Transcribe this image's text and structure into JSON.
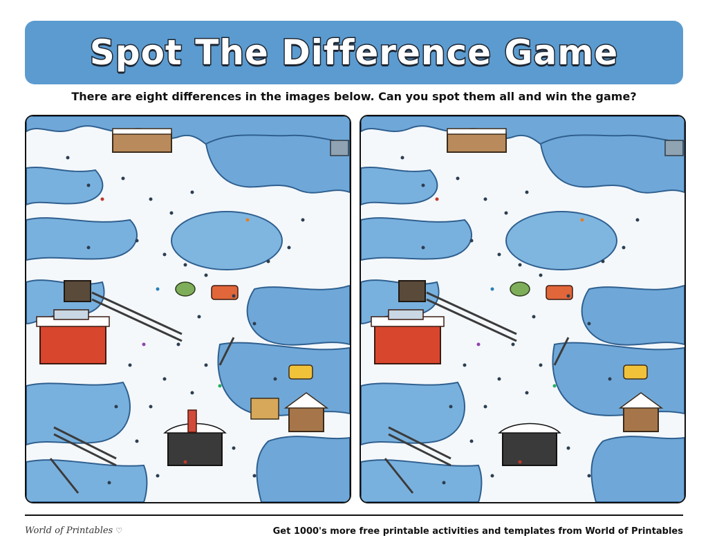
{
  "header": {
    "title": "Spot The Difference Game",
    "banner_color": "#5b9bd0"
  },
  "instructions": "There are eight differences in the images below. Can you spot them all and win the game?",
  "panels": [
    {
      "id": "left",
      "role": "original"
    },
    {
      "id": "right",
      "role": "altered"
    }
  ],
  "footer": {
    "brand": "World of Printables",
    "brand_icon": "heart-icon",
    "note": "Get 1000's more free printable activities and templates from World of Printables"
  }
}
